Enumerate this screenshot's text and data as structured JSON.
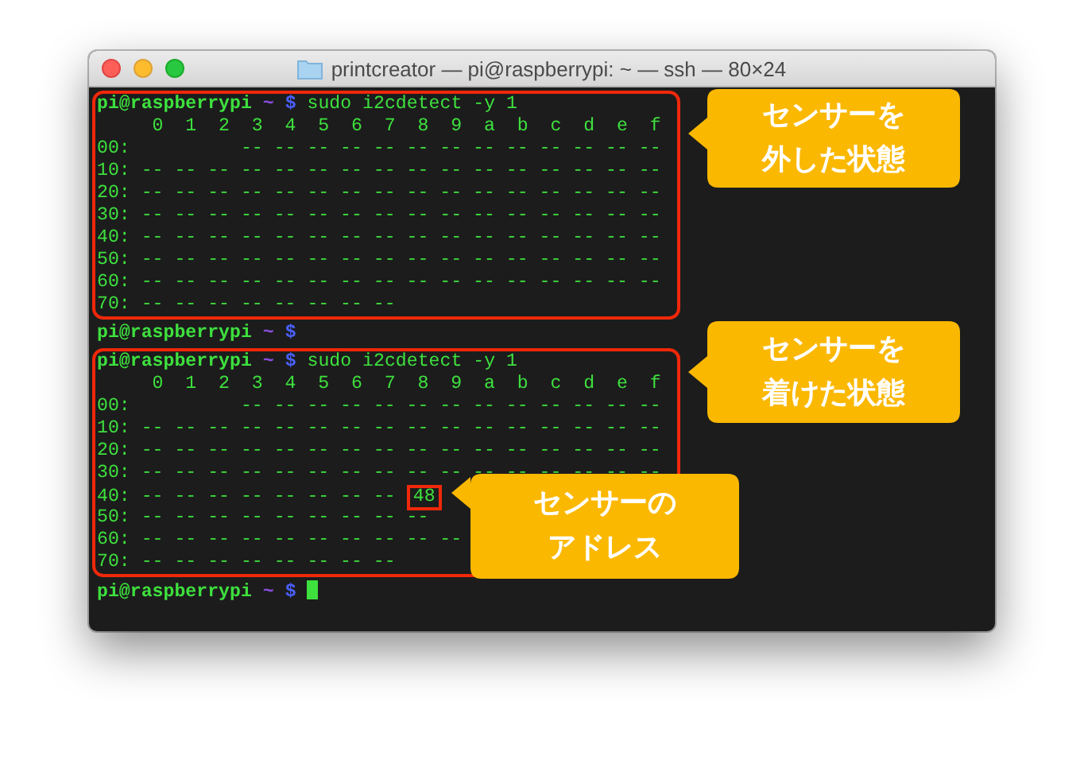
{
  "window": {
    "title": "printcreator — pi@raspberrypi: ~ — ssh — 80×24"
  },
  "terminal": {
    "blocks": [
      {
        "highlighted": true,
        "prompt": {
          "user": "pi@raspberrypi",
          "path": "~",
          "symbol": "$",
          "command": "sudo i2cdetect -y 1"
        },
        "rows": [
          {
            "text": "     0  1  2  3  4  5  6  7  8  9  a  b  c  d  e  f"
          },
          {
            "text": "00:          -- -- -- -- -- -- -- -- -- -- -- -- --"
          },
          {
            "text": "10: -- -- -- -- -- -- -- -- -- -- -- -- -- -- -- --"
          },
          {
            "text": "20: -- -- -- -- -- -- -- -- -- -- -- -- -- -- -- --"
          },
          {
            "text": "30: -- -- -- -- -- -- -- -- -- -- -- -- -- -- -- --"
          },
          {
            "text": "40: -- -- -- -- -- -- -- -- -- -- -- -- -- -- -- --"
          },
          {
            "text": "50: -- -- -- -- -- -- -- -- -- -- -- -- -- -- -- --"
          },
          {
            "text": "60: -- -- -- -- -- -- -- -- -- -- -- -- -- -- -- --"
          },
          {
            "text": "70: -- -- -- -- -- -- -- --"
          }
        ]
      },
      {
        "highlighted": false,
        "prompt": {
          "user": "pi@raspberrypi",
          "path": "~",
          "symbol": "$"
        }
      },
      {
        "highlighted": true,
        "prompt": {
          "user": "pi@raspberrypi",
          "path": "~",
          "symbol": "$",
          "command": "sudo i2cdetect -y 1"
        },
        "rows": [
          {
            "text": "     0  1  2  3  4  5  6  7  8  9  a  b  c  d  e  f"
          },
          {
            "text": "00:          -- -- -- -- -- -- -- -- -- -- -- -- --"
          },
          {
            "text": "10: -- -- -- -- -- -- -- -- -- -- -- -- -- -- -- --"
          },
          {
            "text": "20: -- -- -- -- -- -- -- -- -- -- -- -- -- -- -- --"
          },
          {
            "text": "30: -- -- -- -- -- -- -- -- -- -- -- -- -- -- -- --"
          },
          {
            "text": "40: -- -- -- -- -- -- -- --",
            "address": "48"
          },
          {
            "text": "50: -- -- -- -- -- -- -- -- --"
          },
          {
            "text": "60: -- -- -- -- -- -- -- -- -- --"
          },
          {
            "text": "70: -- -- -- -- -- -- -- --"
          }
        ]
      },
      {
        "highlighted": false,
        "prompt": {
          "user": "pi@raspberrypi",
          "path": "~",
          "symbol": "$"
        },
        "cursor": true
      }
    ]
  },
  "callouts": [
    {
      "lines": [
        "センサーを",
        "外した状態"
      ]
    },
    {
      "lines": [
        "センサーを",
        "着けた状態"
      ]
    },
    {
      "lines": [
        "センサーの",
        "アドレス"
      ]
    }
  ]
}
